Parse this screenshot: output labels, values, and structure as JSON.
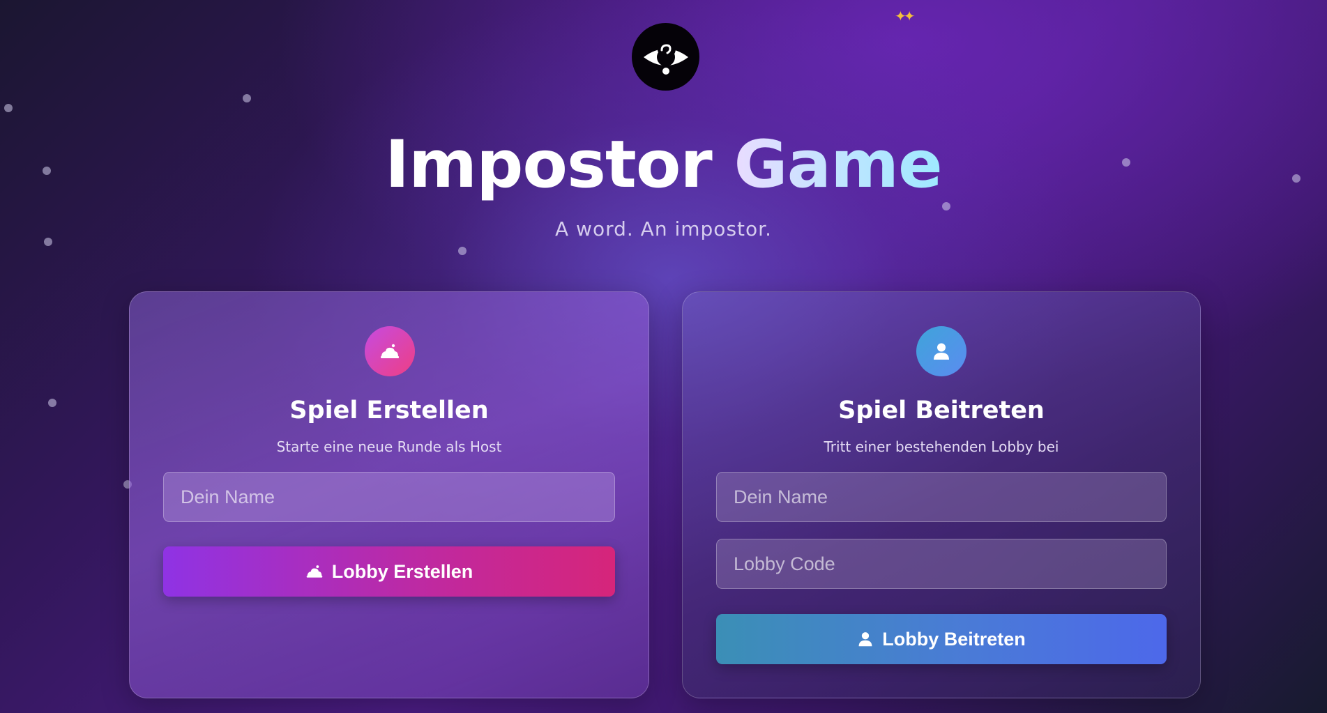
{
  "header": {
    "logo_icon": "question-eye-icon",
    "title_part1": "Impostor",
    "title_part2": "Game",
    "subtitle": "A word. An impostor."
  },
  "create_card": {
    "icon": "host-cloud-icon",
    "title": "Spiel Erstellen",
    "description": "Starte eine neue Runde als Host",
    "name_placeholder": "Dein Name",
    "button_icon": "host-cloud-icon",
    "button_label": "Lobby Erstellen"
  },
  "join_card": {
    "icon": "user-icon",
    "title": "Spiel Beitreten",
    "description": "Tritt einer bestehenden Lobby bei",
    "name_placeholder": "Dein Name",
    "code_placeholder": "Lobby Code",
    "button_icon": "user-icon",
    "button_label": "Lobby Beitreten"
  },
  "colors": {
    "create_accent_start": "#8f33e4",
    "create_accent_end": "#d6257a",
    "join_accent_start": "#3b8fb6",
    "join_accent_end": "#4d68ea"
  }
}
